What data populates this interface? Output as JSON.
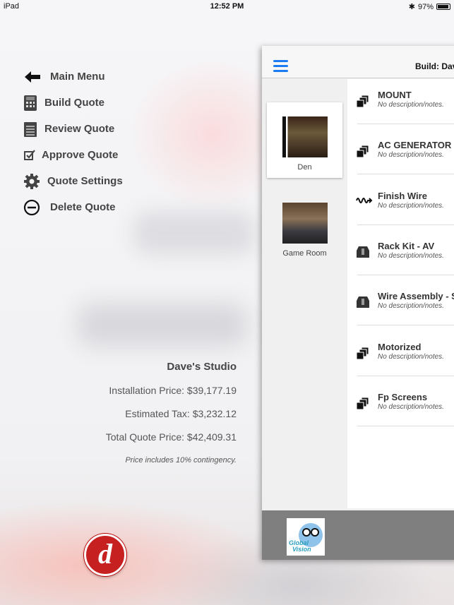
{
  "status": {
    "device": "iPad",
    "time": "12:52 PM",
    "battery": "97%"
  },
  "menu": [
    {
      "label": "Main Menu",
      "icon": "arrow-left-icon"
    },
    {
      "label": "Build Quote",
      "icon": "calculator-icon"
    },
    {
      "label": "Review Quote",
      "icon": "notepad-icon"
    },
    {
      "label": "Approve Quote",
      "icon": "checkbox-icon"
    },
    {
      "label": "Quote Settings",
      "icon": "gear-icon"
    },
    {
      "label": "Delete Quote",
      "icon": "minus-circle-icon"
    }
  ],
  "summary": {
    "name": "Dave's Studio",
    "installation": "Installation Price: $39,177.19",
    "tax": "Estimated Tax:  $3,232.12",
    "total": "Total Quote Price: $42,409.31",
    "note": "Price includes 10% contingency."
  },
  "panel": {
    "title": "Build: Dav",
    "rooms": [
      {
        "label": "Den",
        "selected": true
      },
      {
        "label": "Game Room",
        "selected": false
      }
    ],
    "items": [
      {
        "name": "MOUNT",
        "desc": "No description/notes.",
        "icon": "stack-icon"
      },
      {
        "name": "AC GENERATOR",
        "desc": "No description/notes.",
        "icon": "stack-icon"
      },
      {
        "name": "Finish Wire",
        "desc": "No description/notes.",
        "icon": "wire-icon"
      },
      {
        "name": "Rack Kit - AV",
        "desc": "No description/notes.",
        "icon": "box-icon"
      },
      {
        "name": "Wire Assembly - S",
        "desc": "No description/notes.",
        "icon": "box-icon"
      },
      {
        "name": "Motorized",
        "desc": "No description/notes.",
        "icon": "stack-icon"
      },
      {
        "name": "Fp Screens",
        "desc": "No description/notes.",
        "icon": "stack-icon"
      }
    ],
    "footer_logo": "Global Vision LTD"
  },
  "colors": {
    "accent": "#1a7cf0",
    "footer": "#7f7f7f",
    "logo_red": "#c62020"
  }
}
